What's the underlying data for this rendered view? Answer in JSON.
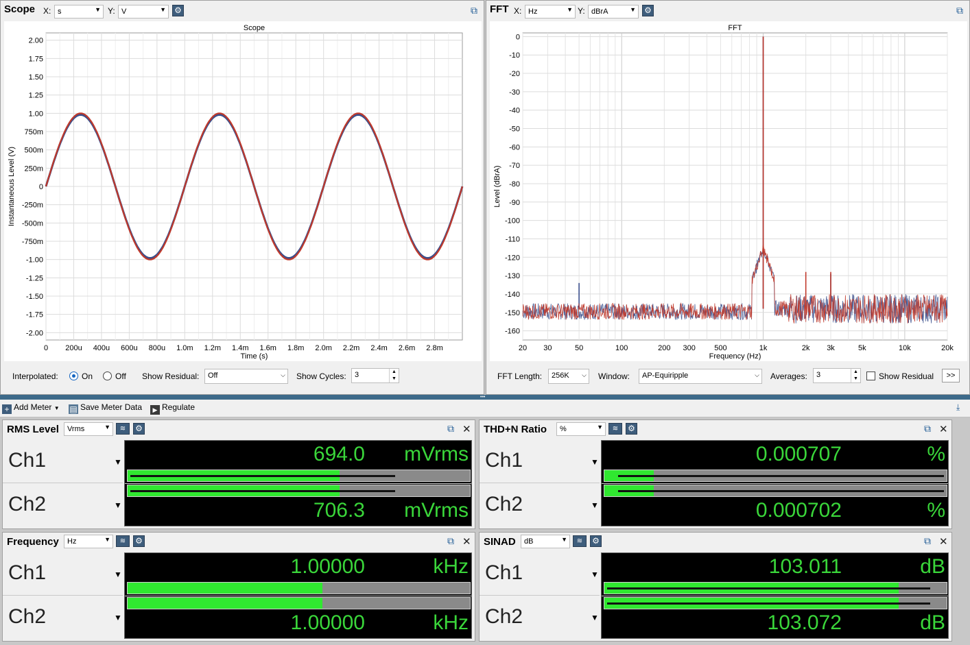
{
  "scope": {
    "title": "Scope",
    "x_label": "X:",
    "x_unit": "s",
    "y_label": "Y:",
    "y_unit": "V",
    "interpolated_label": "Interpolated:",
    "on_label": "On",
    "off_label": "Off",
    "show_residual_label": "Show Residual:",
    "show_residual_value": "Off",
    "show_cycles_label": "Show Cycles:",
    "show_cycles_value": "3"
  },
  "fft": {
    "title": "FFT",
    "x_label": "X:",
    "x_unit": "Hz",
    "y_label": "Y:",
    "y_unit": "dBrA",
    "fft_length_label": "FFT Length:",
    "fft_length_value": "256K",
    "window_label": "Window:",
    "window_value": "AP-Equiripple",
    "averages_label": "Averages:",
    "averages_value": "3",
    "show_residual_label": "Show Residual",
    "more_button": ">>"
  },
  "chart_data": [
    {
      "type": "line",
      "title": "Scope",
      "xlabel": "Time (s)",
      "ylabel": "Instantaneous Level (V)",
      "xlim": [
        0,
        0.003
      ],
      "ylim": [
        -2.1,
        2.1
      ],
      "x_ticks": [
        "0",
        "200u",
        "400u",
        "600u",
        "800u",
        "1.0m",
        "1.2m",
        "1.4m",
        "1.6m",
        "1.8m",
        "2.0m",
        "2.2m",
        "2.4m",
        "2.6m",
        "2.8m"
      ],
      "y_ticks": [
        "2.00",
        "1.75",
        "1.50",
        "1.25",
        "1.00",
        "750m",
        "500m",
        "250m",
        "0",
        "-250m",
        "-500m",
        "-750m",
        "-1.00",
        "-1.25",
        "-1.50",
        "-1.75",
        "-2.00"
      ],
      "grid": true,
      "series": [
        {
          "name": "Ch1",
          "color": "#3a4f8c",
          "frequency_hz": 1000,
          "amplitude_v": 0.98
        },
        {
          "name": "Ch2",
          "color": "#c0392b",
          "frequency_hz": 1000,
          "amplitude_v": 1.0
        }
      ]
    },
    {
      "type": "line",
      "title": "FFT",
      "xlabel": "Frequency (Hz)",
      "ylabel": "Level (dBrA)",
      "x_scale": "log",
      "xlim": [
        20,
        20000
      ],
      "ylim": [
        -165,
        2
      ],
      "x_ticks": [
        "20",
        "30",
        "50",
        "100",
        "200",
        "300",
        "500",
        "1k",
        "2k",
        "3k",
        "5k",
        "10k",
        "20k"
      ],
      "y_ticks": [
        "0",
        "-10",
        "-20",
        "-30",
        "-40",
        "-50",
        "-60",
        "-70",
        "-80",
        "-90",
        "-100",
        "-110",
        "-120",
        "-130",
        "-140",
        "-150",
        "-160"
      ],
      "grid": true,
      "noise_floor_db": -148,
      "series": [
        {
          "name": "Ch1",
          "color": "#3a4f8c",
          "peaks": [
            {
              "x": 50,
              "y": -134
            },
            {
              "x": 1000,
              "y": 0
            },
            {
              "x": 3000,
              "y": -129
            }
          ]
        },
        {
          "name": "Ch2",
          "color": "#c0392b",
          "peaks": [
            {
              "x": 1000,
              "y": 0
            },
            {
              "x": 2000,
              "y": -128
            },
            {
              "x": 3000,
              "y": -128
            }
          ]
        }
      ]
    }
  ],
  "toolbar": {
    "add_meter": "Add Meter",
    "save_meter_data": "Save Meter Data",
    "regulate": "Regulate"
  },
  "meters": {
    "rms": {
      "title": "RMS Level",
      "unit_select": "Vrms",
      "ch1": {
        "label": "Ch1",
        "value": "694.0",
        "unit": "mVrms",
        "bar_fraction": 0.62,
        "peak_fraction": 0.79
      },
      "ch2": {
        "label": "Ch2",
        "value": "706.3",
        "unit": "mVrms",
        "bar_fraction": 0.62,
        "peak_fraction": 0.79
      }
    },
    "thdn": {
      "title": "THD+N Ratio",
      "unit_select": "%",
      "ch1": {
        "label": "Ch1",
        "value": "0.000707",
        "unit": "%",
        "bar_fraction": 0.145,
        "peak_fraction": 1.0
      },
      "ch2": {
        "label": "Ch2",
        "value": "0.000702",
        "unit": "%",
        "bar_fraction": 0.145,
        "peak_fraction": 1.0
      }
    },
    "freq": {
      "title": "Frequency",
      "unit_select": "Hz",
      "ch1": {
        "label": "Ch1",
        "value": "1.00000",
        "unit": "kHz",
        "bar_fraction": 0.57,
        "peak_fraction": 0
      },
      "ch2": {
        "label": "Ch2",
        "value": "1.00000",
        "unit": "kHz",
        "bar_fraction": 0.57,
        "peak_fraction": 0
      }
    },
    "sinad": {
      "title": "SINAD",
      "unit_select": "dB",
      "ch1": {
        "label": "Ch1",
        "value": "103.011",
        "unit": "dB",
        "bar_fraction": 0.86,
        "peak_fraction": 0.96
      },
      "ch2": {
        "label": "Ch2",
        "value": "103.072",
        "unit": "dB",
        "bar_fraction": 0.86,
        "peak_fraction": 0.96
      }
    }
  }
}
